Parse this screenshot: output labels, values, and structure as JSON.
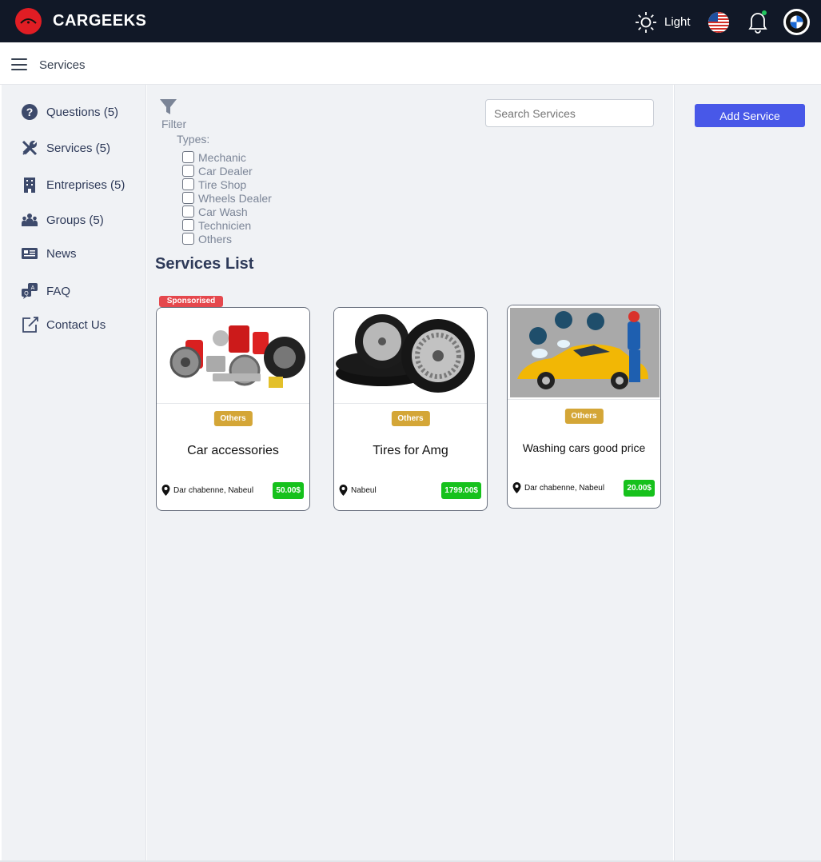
{
  "app": {
    "brand": "CARGEEKS",
    "theme_label": "Light"
  },
  "breadcrumb": {
    "label": "Services"
  },
  "sidebar": {
    "items": [
      {
        "label": "Questions (5)",
        "icon": "question-circle-icon"
      },
      {
        "label": "Services (5)",
        "icon": "tools-icon"
      },
      {
        "label": "Entreprises (5)",
        "icon": "building-icon"
      },
      {
        "label": "Groups (5)",
        "icon": "group-icon"
      },
      {
        "label": "News",
        "icon": "newspaper-icon"
      },
      {
        "label": "FAQ",
        "icon": "faq-icon"
      },
      {
        "label": "Contact Us",
        "icon": "edit-icon"
      }
    ]
  },
  "filter": {
    "label": "Filter",
    "types_label": "Types:",
    "types": [
      "Mechanic",
      "Car Dealer",
      "Tire Shop",
      "Wheels Dealer",
      "Car Wash",
      "Technicien",
      "Others"
    ]
  },
  "search": {
    "placeholder": "Search Services"
  },
  "services": {
    "title": "Services List",
    "sponsored_label": "Sponsorised",
    "cards": [
      {
        "title": "Car accessories",
        "category": "Others",
        "location": "Dar chabenne, Nabeul",
        "price": "50.00$"
      },
      {
        "title": "Tires for Amg",
        "category": "Others",
        "location": "Nabeul",
        "price": "1799.00$"
      },
      {
        "title": "Washing cars good price",
        "category": "Others",
        "location": "Dar chabenne, Nabeul",
        "price": "20.00$"
      }
    ]
  },
  "actions": {
    "add_service": "Add Service"
  },
  "colors": {
    "topbar": "#111827",
    "accent": "#4858e8",
    "badge": "#d4a637",
    "price": "#16c11c",
    "sponsored": "#e5484d"
  }
}
